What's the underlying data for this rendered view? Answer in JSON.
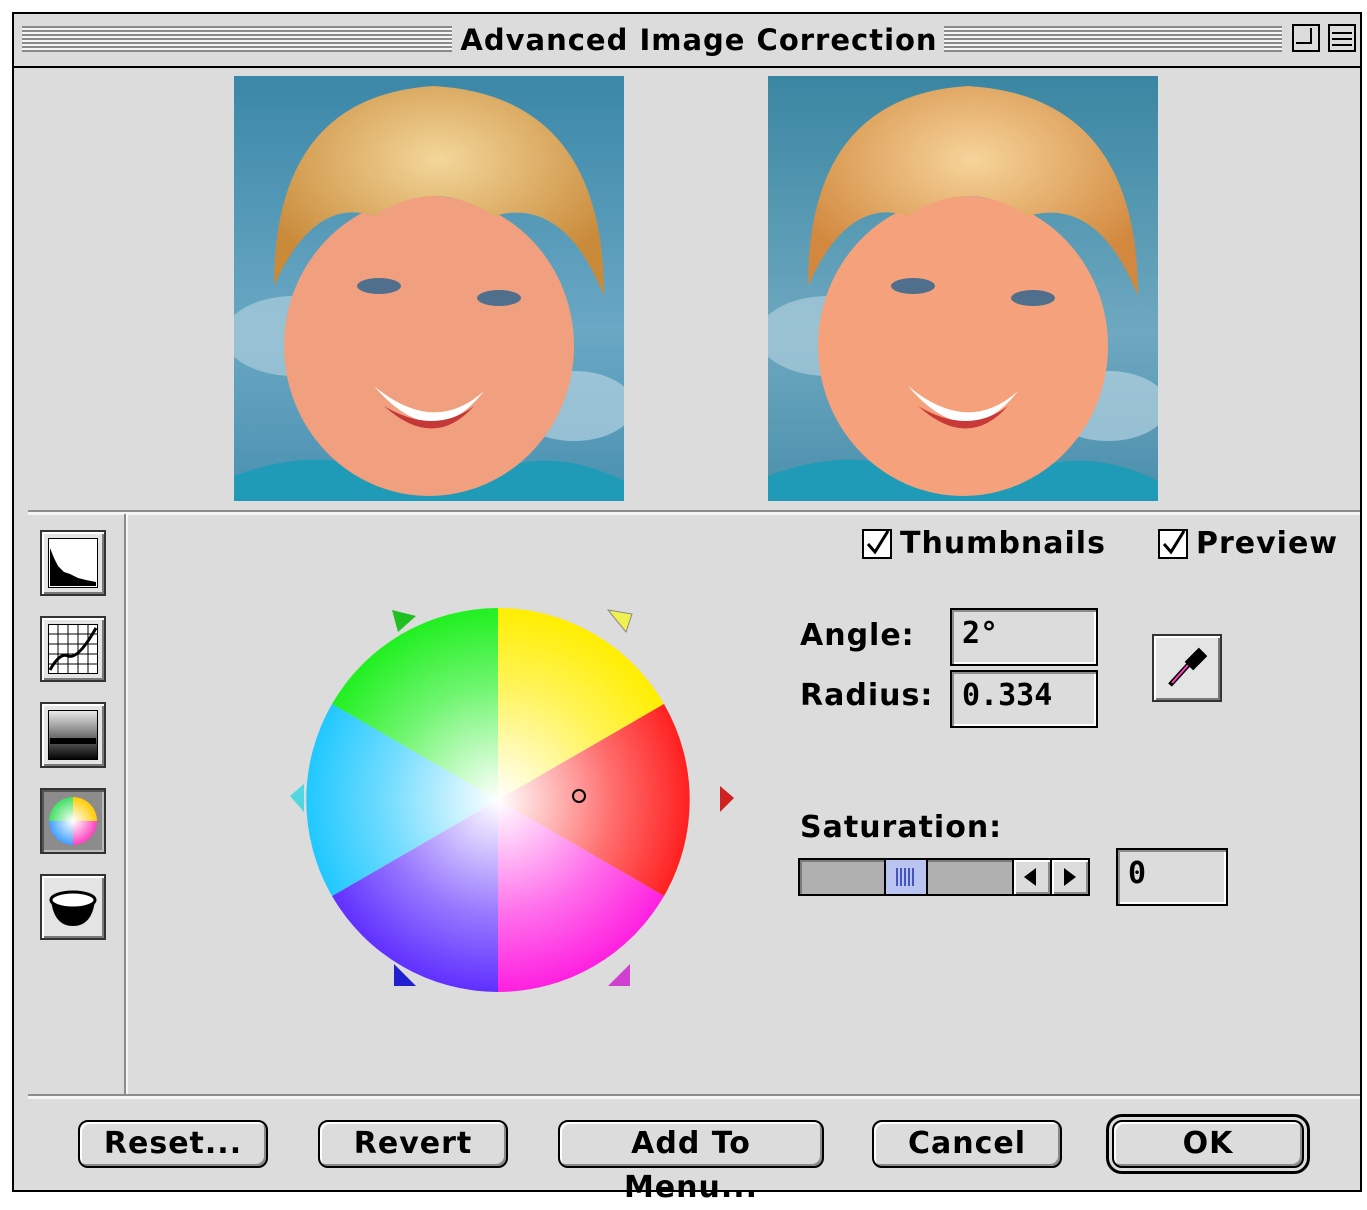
{
  "window": {
    "title": "Advanced Image Correction"
  },
  "previews": {
    "original_label": "",
    "corrected_label": ""
  },
  "options": {
    "thumbnails_label": "Thumbnails",
    "thumbnails_checked": true,
    "preview_label": "Preview",
    "preview_checked": true
  },
  "tools": [
    {
      "name": "histogram-tool",
      "icon": "histogram-icon",
      "active": false
    },
    {
      "name": "curves-tool",
      "icon": "curves-icon",
      "active": false
    },
    {
      "name": "levels-tool",
      "icon": "gradient-icon",
      "active": false
    },
    {
      "name": "color-balance-tool",
      "icon": "color-wheel-icon",
      "active": true
    },
    {
      "name": "bowl-tool",
      "icon": "bowl-icon",
      "active": false
    }
  ],
  "color_balance": {
    "angle_label": "Angle:",
    "angle_value": "2°",
    "radius_label": "Radius:",
    "radius_value": "0.334",
    "saturation_label": "Saturation:",
    "saturation_value": "0"
  },
  "buttons": {
    "reset": "Reset...",
    "revert": "Revert",
    "add_to_menu": "Add To Menu...",
    "cancel": "Cancel",
    "ok": "OK"
  }
}
